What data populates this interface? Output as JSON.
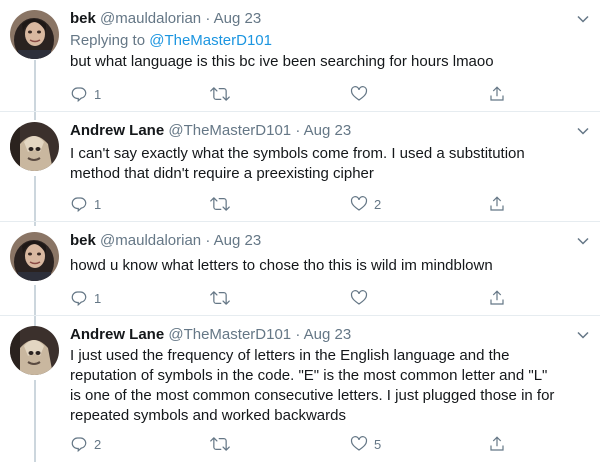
{
  "tweets": [
    {
      "name": "bek",
      "handle": "@mauldalorian",
      "separator": "·",
      "date": "Aug 23",
      "replying_prefix": "Replying to",
      "replying_handle": "@TheMasterD101",
      "text": "but what language is this bc ive been searching for hours lmaoo",
      "replies": "1",
      "retweets": "",
      "likes": ""
    },
    {
      "name": "Andrew Lane",
      "handle": "@TheMasterD101",
      "separator": "·",
      "date": "Aug 23",
      "text_lines": [
        "I can't say exactly what the symbols come from. I used a substitution",
        "method that didn't require a preexisting cipher"
      ],
      "replies": "1",
      "retweets": "",
      "likes": "2"
    },
    {
      "name": "bek",
      "handle": "@mauldalorian",
      "separator": "·",
      "date": "Aug 23",
      "text": "howd u know what letters to chose tho this is wild im mindblown",
      "replies": "1",
      "retweets": "",
      "likes": ""
    },
    {
      "name": "Andrew Lane",
      "handle": "@TheMasterD101",
      "separator": "·",
      "date": "Aug 23",
      "text_lines": [
        "I just used the frequency of letters in the English language and the",
        "reputation of symbols in the code. \"E\" is the most common letter and \"L\"",
        "is one of the most common consecutive letters. I just plugged those in for",
        "repeated symbols and worked backwards"
      ],
      "replies": "2",
      "retweets": "",
      "likes": "5"
    }
  ],
  "icons": {
    "reply": "reply-icon",
    "retweet": "retweet-icon",
    "like": "heart-icon",
    "share": "share-icon",
    "more": "chevron-down-icon"
  },
  "colors": {
    "text": "#14171a",
    "muted": "#657786",
    "link": "#1b95e0",
    "divider": "#e6ecf0"
  }
}
